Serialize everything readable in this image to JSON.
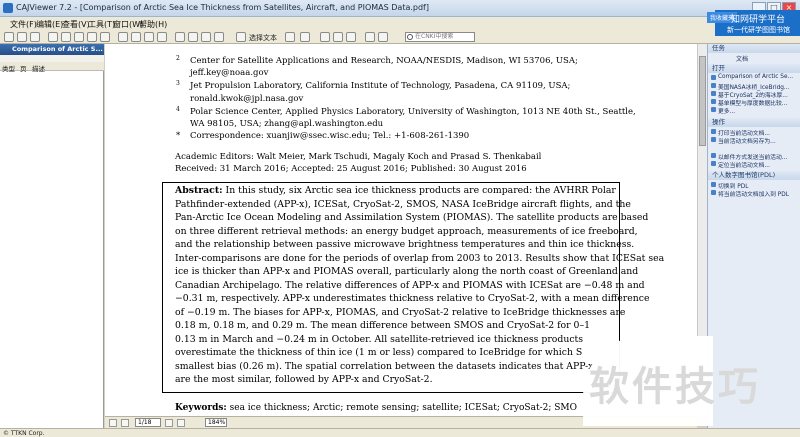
{
  "window": {
    "title": "CAJViewer 7.2 - [Comparison of Arctic Sea Ice Thickness from Satellites, Aircraft, and PIOMAS Data.pdf]",
    "minimize": "_",
    "maximize": "□",
    "close": "×"
  },
  "menu": [
    "文件(F)",
    "编辑(E)",
    "查看(V)",
    "工具(T)",
    "窗口(W)",
    "帮助(H)"
  ],
  "toolbar": {
    "select_text": "选择文本",
    "search_placeholder": "在CNKI中搜索"
  },
  "promo": {
    "button": "我收藏夹",
    "line1": "知网研学平台",
    "line2": "新一代研学图图书馆"
  },
  "left_panel": {
    "doc_tab": "Comparison of Arctic S...",
    "headers": [
      "类型",
      "页",
      "描述"
    ]
  },
  "document": {
    "affiliations": [
      {
        "num": "2",
        "lines": [
          "Center for Satellite Applications and Research, NOAA/NESDIS, Madison, WI 53706, USA;",
          "jeff.key@noaa.gov"
        ]
      },
      {
        "num": "3",
        "lines": [
          "Jet Propulsion Laboratory, California Institute of Technology, Pasadena, CA 91109, USA;",
          "ronald.kwok@jpl.nasa.gov"
        ]
      },
      {
        "num": "4",
        "lines": [
          "Polar Science Center, Applied Physics Laboratory, University of Washington, 1013 NE 40th St., Seattle,",
          "WA 98105, USA; zhang@apl.washington.edu"
        ]
      },
      {
        "num": "*",
        "lines": [
          "Correspondence: xuanjiw@ssec.wisc.edu; Tel.: +1-608-261-1390"
        ]
      }
    ],
    "editors": "Academic Editors: Walt Meier, Mark Tschudi, Magaly Koch and Prasad S. Thenkabail",
    "received": "Received: 31 March 2016; Accepted: 25 August 2016; Published: 30 August 2016",
    "abstract_label": "Abstract:",
    "abstract_lines": [
      " In this study, six Arctic sea ice thickness products are compared:  the AVHRR Polar",
      "Pathfinder-extended (APP-x), ICESat, CryoSat-2, SMOS, NASA IceBridge aircraft flights, and the",
      "Pan-Arctic Ice Ocean Modeling and Assimilation System (PIOMAS). The satellite products are based",
      "on three different retrieval methods: an energy budget approach, measurements of ice freeboard,",
      "and the relationship between passive microwave brightness temperatures and thin ice thickness.",
      "Inter-comparisons are done for the periods of overlap from 2003 to 2013.  Results show that ICESat sea",
      "ice is thicker than APP-x and PIOMAS overall, particularly along the north coast of Greenland and",
      "Canadian Archipelago. The relative differences of APP-x and PIOMAS with ICESat are −0.48 m and",
      "−0.31 m, respectively. APP-x underestimates thickness relative to CryoSat-2, with a mean difference",
      "of −0.19 m.  The biases for APP-x, PIOMAS, and CryoSat-2 relative to IceBridge thicknesses are",
      "0.18 m, 0.18 m, and 0.29 m.  The mean difference between SMOS and CryoSat-2 for 0–1",
      "0.13 m in March and −0.24 m in October.  All satellite-retrieved ice thickness products",
      "overestimate the thickness of thin ice (1 m or less) compared to IceBridge for which S",
      "smallest bias (0.26 m). The spatial correlation between the datasets indicates that APP-x",
      "are the most similar, followed by APP-x and CryoSat-2."
    ],
    "keywords_label": "Keywords:",
    "keywords": " sea ice thickness; Arctic; remote sensing; satellite; ICESat; CryoSat-2; SMO"
  },
  "right_panel": {
    "tab_title": "任务",
    "tab_sub": "文档",
    "section_docs": "打开",
    "docs": [
      "Comparison of Arctic Se...",
      "美国NASA冰桥_IceBridg...",
      "基于CryoSat_2的海冰厚...",
      "基单模型与厚度数据比较...",
      "更多..."
    ],
    "section_ops": "操作",
    "ops": [
      "打印当前活动文档...",
      "当前活动文档另存为..."
    ],
    "ops2": [
      "以邮件方式发送当前活动...",
      "定位当前活动文档..."
    ],
    "section_personal": "个人数字图书馆(PDL)",
    "personal": [
      "切换到 PDL",
      "将当前活动文档加入到 PDL"
    ]
  },
  "nav": {
    "page": "1/18",
    "zoom": "184%"
  },
  "status": {
    "corp": "© TTKN Corp."
  },
  "watermark": "软件技巧"
}
